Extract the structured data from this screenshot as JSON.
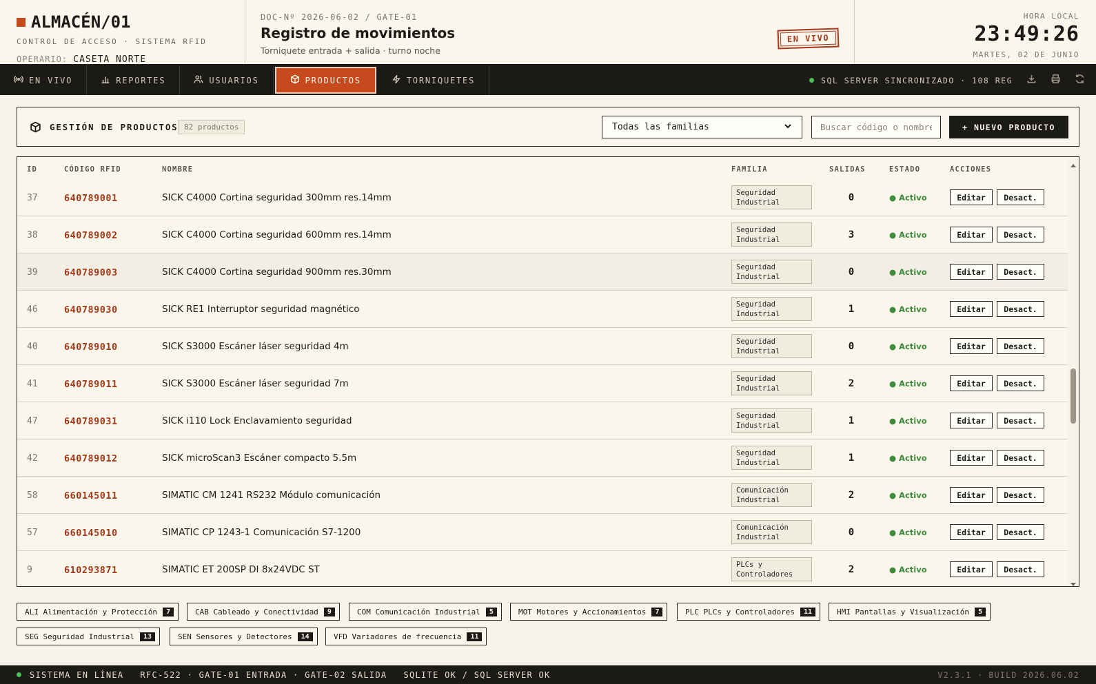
{
  "header": {
    "brand": "ALMACÉN/01",
    "brand_sub": "CONTROL DE ACCESO · SISTEMA RFID",
    "operator_label": "OPERARIO:",
    "operator_value": "CASETA NORTE",
    "doc_number": "DOC-Nº 2026-06-02 / GATE-01",
    "doc_title": "Registro de movimientos",
    "doc_sub": "Torniquete entrada + salida · turno noche",
    "stamp": "EN VIVO",
    "clock_label": "HORA LOCAL",
    "clock_time": "23:49:26",
    "clock_date": "MARTES, 02 DE JUNIO",
    "accent": "#c64a1e"
  },
  "nav": {
    "tabs": [
      {
        "label": "EN VIVO",
        "icon": "broadcast-icon"
      },
      {
        "label": "REPORTES",
        "icon": "bar-chart-icon"
      },
      {
        "label": "USUARIOS",
        "icon": "users-icon"
      },
      {
        "label": "PRODUCTOS",
        "icon": "box-icon",
        "active": true
      },
      {
        "label": "TORNIQUETES",
        "icon": "bolt-icon"
      }
    ],
    "sync_text": "SQL SERVER SINCRONIZADO · 108 REG"
  },
  "panel": {
    "title": "GESTIÓN DE PRODUCTOS",
    "count": "82 productos",
    "family_select": "Todas las familias",
    "search_placeholder": "Buscar código o nombre",
    "new_button": "+ NUEVO PRODUCTO"
  },
  "table": {
    "headers": {
      "id": "ID",
      "code": "CÓDIGO RFID",
      "name": "NOMBRE",
      "family": "FAMILIA",
      "exits": "SALIDAS",
      "status": "ESTADO",
      "actions": "ACCIONES"
    },
    "edit_label": "Editar",
    "deactivate_label": "Desact.",
    "rows": [
      {
        "id": "37",
        "code": "640789001",
        "name": "SICK C4000 Cortina seguridad 300mm res.14mm",
        "family": "Seguridad Industrial",
        "exits": "0",
        "status": "● Activo"
      },
      {
        "id": "38",
        "code": "640789002",
        "name": "SICK C4000 Cortina seguridad 600mm res.14mm",
        "family": "Seguridad Industrial",
        "exits": "3",
        "status": "● Activo"
      },
      {
        "id": "39",
        "code": "640789003",
        "name": "SICK C4000 Cortina seguridad 900mm res.30mm",
        "family": "Seguridad Industrial",
        "exits": "0",
        "status": "● Activo"
      },
      {
        "id": "46",
        "code": "640789030",
        "name": "SICK RE1 Interruptor seguridad magnético",
        "family": "Seguridad Industrial",
        "exits": "1",
        "status": "● Activo"
      },
      {
        "id": "40",
        "code": "640789010",
        "name": "SICK S3000 Escáner láser seguridad 4m",
        "family": "Seguridad Industrial",
        "exits": "0",
        "status": "● Activo"
      },
      {
        "id": "41",
        "code": "640789011",
        "name": "SICK S3000 Escáner láser seguridad 7m",
        "family": "Seguridad Industrial",
        "exits": "2",
        "status": "● Activo"
      },
      {
        "id": "47",
        "code": "640789031",
        "name": "SICK i110 Lock Enclavamiento seguridad",
        "family": "Seguridad Industrial",
        "exits": "1",
        "status": "● Activo"
      },
      {
        "id": "42",
        "code": "640789012",
        "name": "SICK microScan3 Escáner compacto 5.5m",
        "family": "Seguridad Industrial",
        "exits": "1",
        "status": "● Activo"
      },
      {
        "id": "58",
        "code": "660145011",
        "name": "SIMATIC CM 1241 RS232 Módulo comunicación",
        "family": "Comunicación Industrial",
        "exits": "2",
        "status": "● Activo"
      },
      {
        "id": "57",
        "code": "660145010",
        "name": "SIMATIC CP 1243-1 Comunicación S7-1200",
        "family": "Comunicación Industrial",
        "exits": "0",
        "status": "● Activo"
      },
      {
        "id": "9",
        "code": "610293871",
        "name": "SIMATIC ET 200SP DI 8x24VDC ST",
        "family": "PLCs y Controladores",
        "exits": "2",
        "status": "● Activo"
      }
    ]
  },
  "families": [
    {
      "label": "ALI Alimentación y Protección",
      "count": "7"
    },
    {
      "label": "CAB Cableado y Conectividad",
      "count": "9"
    },
    {
      "label": "COM Comunicación Industrial",
      "count": "5"
    },
    {
      "label": "MOT Motores y Accionamientos",
      "count": "7"
    },
    {
      "label": "PLC PLCs y Controladores",
      "count": "11"
    },
    {
      "label": "HMI Pantallas y Visualización",
      "count": "5"
    },
    {
      "label": "SEG Seguridad Industrial",
      "count": "13"
    },
    {
      "label": "SEN Sensores y Detectores",
      "count": "14"
    },
    {
      "label": "VFD Variadores de frecuencia",
      "count": "11"
    }
  ],
  "footer": {
    "status": "SISTEMA EN LÍNEA",
    "devices": "RFC-522 · GATE-01 ENTRADA · GATE-02 SALIDA",
    "db": "SQLITE OK / SQL SERVER OK",
    "version": "V2.3.1 · BUILD 2026.06.02"
  }
}
